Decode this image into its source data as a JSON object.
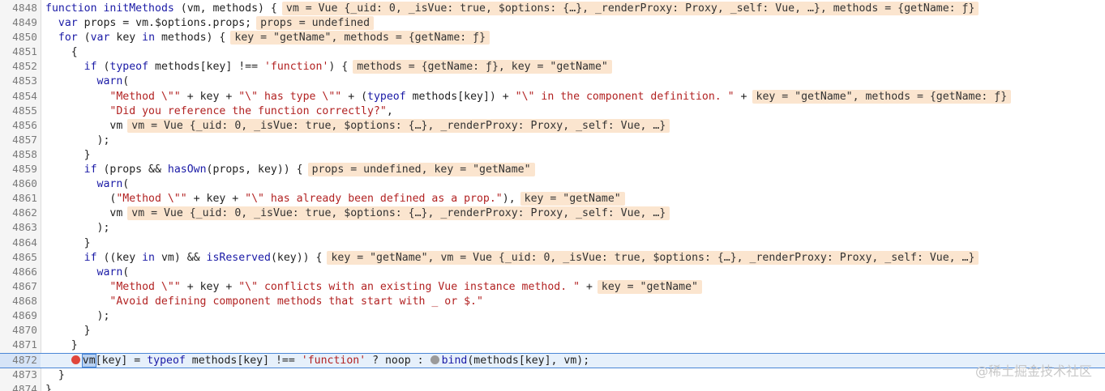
{
  "lines": [
    {
      "n": "4848",
      "text": "function initMethods (vm, methods) {",
      "inline": "vm = Vue {_uid: 0, _isVue: true, $options: {…}, _renderProxy: Proxy, _self: Vue, …}, methods = {getName: ƒ}"
    },
    {
      "n": "4849",
      "text": "  var props = vm.$options.props;",
      "inline": "props = undefined"
    },
    {
      "n": "4850",
      "text": "  for (var key in methods) {",
      "inline": "key = \"getName\", methods = {getName: ƒ}"
    },
    {
      "n": "4851",
      "text": "    {",
      "inline": ""
    },
    {
      "n": "4852",
      "text": "      if (typeof methods[key] !== 'function') {",
      "inline": "methods = {getName: ƒ}, key = \"getName\""
    },
    {
      "n": "4853",
      "text": "        warn(",
      "inline": ""
    },
    {
      "n": "4854",
      "text": "          \"Method \\\"\" + key + \"\\\" has type \\\"\" + (typeof methods[key]) + \"\\\" in the component definition. \" +",
      "inline": "key = \"getName\", methods = {getName: ƒ}"
    },
    {
      "n": "4855",
      "text": "          \"Did you reference the function correctly?\",",
      "inline": ""
    },
    {
      "n": "4856",
      "text": "          vm",
      "inline": "vm = Vue {_uid: 0, _isVue: true, $options: {…}, _renderProxy: Proxy, _self: Vue, …}"
    },
    {
      "n": "4857",
      "text": "        );",
      "inline": ""
    },
    {
      "n": "4858",
      "text": "      }",
      "inline": ""
    },
    {
      "n": "4859",
      "text": "      if (props && hasOwn(props, key)) {",
      "inline": "props = undefined, key = \"getName\""
    },
    {
      "n": "4860",
      "text": "        warn(",
      "inline": ""
    },
    {
      "n": "4861",
      "text": "          (\"Method \\\"\" + key + \"\\\" has already been defined as a prop.\"),",
      "inline": "key = \"getName\""
    },
    {
      "n": "4862",
      "text": "          vm",
      "inline": "vm = Vue {_uid: 0, _isVue: true, $options: {…}, _renderProxy: Proxy, _self: Vue, …}"
    },
    {
      "n": "4863",
      "text": "        );",
      "inline": ""
    },
    {
      "n": "4864",
      "text": "      }",
      "inline": ""
    },
    {
      "n": "4865",
      "text": "      if ((key in vm) && isReserved(key)) {",
      "inline": "key = \"getName\", vm = Vue {_uid: 0, _isVue: true, $options: {…}, _renderProxy: Proxy, _self: Vue, …}"
    },
    {
      "n": "4866",
      "text": "        warn(",
      "inline": ""
    },
    {
      "n": "4867",
      "text": "          \"Method \\\"\" + key + \"\\\" conflicts with an existing Vue instance method. \" +",
      "inline": "key = \"getName\""
    },
    {
      "n": "4868",
      "text": "          \"Avoid defining component methods that start with _ or $.\"",
      "inline": ""
    },
    {
      "n": "4869",
      "text": "        );",
      "inline": ""
    },
    {
      "n": "4870",
      "text": "      }",
      "inline": ""
    },
    {
      "n": "4871",
      "text": "    }",
      "inline": ""
    }
  ],
  "exec_line": {
    "n": "4872",
    "indent": "    ",
    "sel": "vm",
    "part1": "[key] = typeof methods[key] !== 'function' ? noop : ",
    "part2": "bind(methods[key], vm);"
  },
  "tail_lines": [
    {
      "n": "4873",
      "text": "  }"
    },
    {
      "n": "4874",
      "text": "}"
    }
  ],
  "watermark": "@稀土掘金技术社区",
  "colors": {
    "keyword": "#1a1aa6",
    "string": "#b22222",
    "inline_bg": "#fbe5cf",
    "exec_bg": "#e6f0fb",
    "breakpoint": "#e0463b"
  }
}
